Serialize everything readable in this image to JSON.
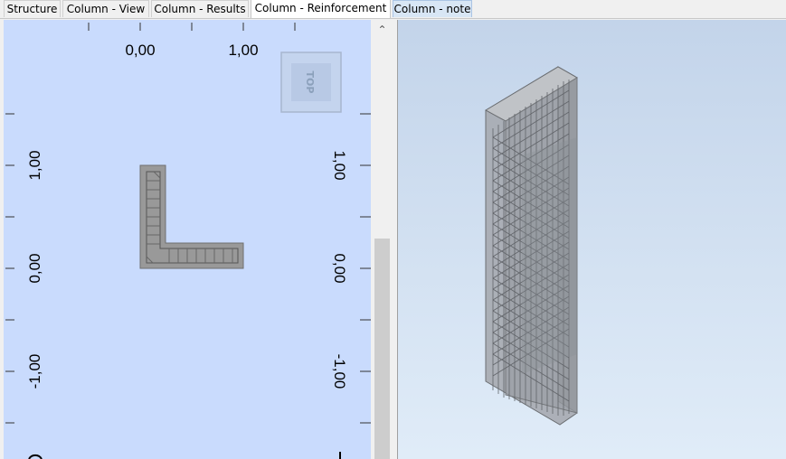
{
  "tabs": [
    {
      "label": "Structure"
    },
    {
      "label": "Column - View"
    },
    {
      "label": "Column - Results"
    },
    {
      "label": "Column - Reinforcement"
    },
    {
      "label": "Column - note"
    }
  ],
  "active_tab": "Column - Reinforcement",
  "section_view": {
    "x_ticks": [
      "0,00",
      "1,00"
    ],
    "y_ticks_left": [
      "1,00",
      "0,00",
      "-1,00"
    ],
    "y_ticks_right": [
      "1,00",
      "0,00",
      "-1,00"
    ],
    "view_cube_label": "TOP"
  },
  "colors": {
    "section_bg": "#c9dbfd",
    "section_fill": "#999999",
    "view3d_bg_top": "#c3d4ea",
    "view3d_bg_bottom": "#e0ecf8"
  }
}
